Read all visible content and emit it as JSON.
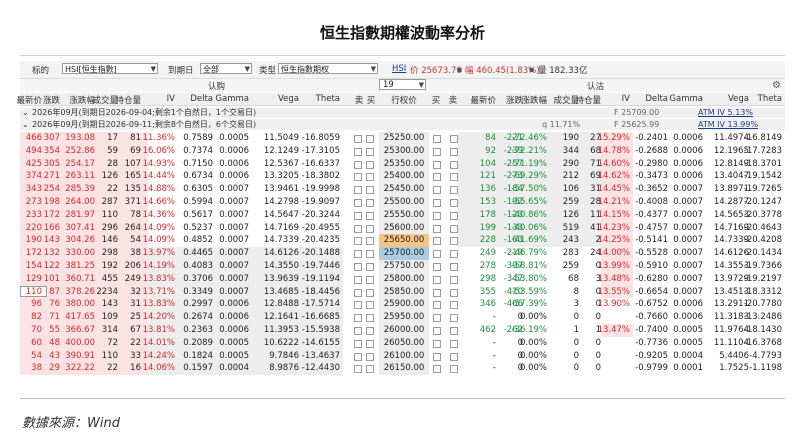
{
  "title": "恒生指數期權波動率分析",
  "source": "數據來源：Wind",
  "toolbar": {
    "underlying_label": "标的",
    "underlying_value": "HSI[恒生指數]",
    "expiry_label": "到期日",
    "expiry_value": "全部",
    "type_label": "类型",
    "type_value": "恒生指數期权",
    "index_link": "HSI",
    "index_price": "价 25673.76",
    "index_change": "幅 460.45(1.83%)",
    "index_volume": "量 182.33亿"
  },
  "section": {
    "call_label": "认购",
    "put_label": "认沽",
    "strike_selector": "19"
  },
  "headers": {
    "call": [
      "最新价",
      "涨跌",
      "涨跌幅",
      "成交量",
      "持仓量",
      "IV",
      "Delta",
      "Gamma",
      "Vega",
      "Theta",
      "卖",
      "买"
    ],
    "middle": [
      "行权价",
      "买",
      "卖"
    ],
    "put": [
      "最新价",
      "涨跌",
      "涨跌幅",
      "成交量",
      "持仓量",
      "IV",
      "Delta",
      "Gamma",
      "Vega",
      "Theta"
    ]
  },
  "groups": [
    {
      "label": "2026年09月(到期日2026-09-04;剩余1个自然日，1个交易日)",
      "right_f": "F 25709.00",
      "right_atm": "ATM IV 5.13%"
    },
    {
      "label": "2026年09月(到期日2026-09-11;剩余8个自然日，6个交易日)",
      "right_q": "q 11.71%",
      "right_f": "F 25625.99",
      "right_atm": "ATM IV 13.99%"
    }
  ],
  "rows": [
    {
      "call": [
        "466",
        "307",
        "193.08",
        "17",
        "81",
        "11.36%",
        "0.7589",
        "0.0005",
        "11.5049",
        "-16.8059"
      ],
      "strike": "25250.00",
      "put": [
        "84",
        "-221",
        "-72.46%",
        "190",
        "27",
        "15.29%",
        "-0.2401",
        "0.0006",
        "11.4974",
        "-16.8149"
      ]
    },
    {
      "call": [
        "494",
        "354",
        "252.86",
        "59",
        "69",
        "16.06%",
        "0.7374",
        "0.0006",
        "12.1249",
        "-17.3105"
      ],
      "strike": "25300.00",
      "put": [
        "92",
        "-239",
        "-72.21%",
        "344",
        "68",
        "14.78%",
        "-0.2688",
        "0.0006",
        "12.1965",
        "-17.7283"
      ]
    },
    {
      "call": [
        "425",
        "305",
        "254.17",
        "28",
        "107",
        "14.93%",
        "0.7150",
        "0.0006",
        "12.5367",
        "-16.6337"
      ],
      "strike": "25350.00",
      "put": [
        "104",
        "-257",
        "-71.19%",
        "290",
        "71",
        "14.60%",
        "-0.2980",
        "0.0006",
        "12.8149",
        "-18.3701"
      ]
    },
    {
      "call": [
        "374",
        "271",
        "263.11",
        "126",
        "165",
        "14.44%",
        "0.6734",
        "0.0006",
        "13.3205",
        "-18.3802"
      ],
      "strike": "25400.00",
      "put": [
        "121",
        "-273",
        "-69.29%",
        "212",
        "69",
        "14.62%",
        "-0.3473",
        "0.0006",
        "13.4047",
        "-19.1542"
      ]
    },
    {
      "call": [
        "343",
        "254",
        "285.39",
        "22",
        "135",
        "14.88%",
        "0.6305",
        "0.0007",
        "13.9461",
        "-19.9998"
      ],
      "strike": "25450.00",
      "put": [
        "136",
        "-184",
        "-57.50%",
        "106",
        "31",
        "14.45%",
        "-0.3652",
        "0.0007",
        "13.8971",
        "-19.7265"
      ]
    },
    {
      "call": [
        "273",
        "198",
        "264.00",
        "287",
        "371",
        "14.66%",
        "0.5994",
        "0.0007",
        "14.2798",
        "-19.9097"
      ],
      "strike": "25500.00",
      "put": [
        "153",
        "-192",
        "-55.65%",
        "259",
        "28",
        "14.21%",
        "-0.4008",
        "0.0007",
        "14.2877",
        "-20.1247"
      ]
    },
    {
      "call": [
        "233",
        "172",
        "281.97",
        "110",
        "78",
        "14.36%",
        "0.5617",
        "0.0007",
        "14.5647",
        "-20.3244"
      ],
      "strike": "25550.00",
      "put": [
        "178",
        "-123",
        "-40.86%",
        "126",
        "11",
        "14.15%",
        "-0.4377",
        "0.0007",
        "14.5653",
        "-20.3778"
      ]
    },
    {
      "call": [
        "220",
        "166",
        "307.41",
        "296",
        "264",
        "14.09%",
        "0.5237",
        "0.0007",
        "14.7169",
        "-20.4955"
      ],
      "strike": "25600.00",
      "put": [
        "199",
        "-133",
        "-40.06%",
        "519",
        "41",
        "14.23%",
        "-0.4757",
        "0.0007",
        "14.7169",
        "-20.4643"
      ]
    },
    {
      "call": [
        "190",
        "143",
        "304.26",
        "146",
        "54",
        "14.09%",
        "0.4852",
        "0.0007",
        "14.7339",
        "-20.4235"
      ],
      "strike": "25650.00",
      "put": [
        "228",
        "-163",
        "-41.69%",
        "243",
        "2",
        "14.25%",
        "-0.5141",
        "0.0007",
        "14.7339",
        "-20.4208"
      ]
    },
    {
      "call": [
        "172",
        "132",
        "330.00",
        "298",
        "38",
        "13.97%",
        "0.4465",
        "0.0007",
        "14.6126",
        "-20.1488"
      ],
      "strike": "25700.00",
      "put": [
        "249",
        "-219",
        "-46.79%",
        "283",
        "24",
        "14.00%",
        "-0.5528",
        "0.0007",
        "14.6126",
        "-20.1434"
      ]
    },
    {
      "call": [
        "154",
        "122",
        "381.25",
        "192",
        "206",
        "14.19%",
        "0.4083",
        "0.0007",
        "14.3550",
        "-19.7446"
      ],
      "strike": "25750.00",
      "put": [
        "278",
        "-397",
        "-58.81%",
        "259",
        "0",
        "13.99%",
        "-0.5910",
        "0.0007",
        "14.3553",
        "-19.7366"
      ]
    },
    {
      "call": [
        "129",
        "101",
        "360.71",
        "455",
        "249",
        "13.83%",
        "0.3706",
        "0.0007",
        "13.9639",
        "-19.1194"
      ],
      "strike": "25800.00",
      "put": [
        "298",
        "-347",
        "-53.80%",
        "68",
        "3",
        "13.48%",
        "-0.6280",
        "0.0007",
        "13.9729",
        "-19.2197"
      ]
    },
    {
      "call": [
        "110",
        "87",
        "378.26",
        "2234",
        "32",
        "13.71%",
        "0.3349",
        "0.0007",
        "13.4685",
        "-18.4456"
      ],
      "strike": "25850.00",
      "put": [
        "355",
        "-410",
        "-53.59%",
        "8",
        "0",
        "13.55%",
        "-0.6654",
        "0.0007",
        "13.4513",
        "-18.3312"
      ]
    },
    {
      "call": [
        "96",
        "76",
        "380.00",
        "143",
        "31",
        "13.83%",
        "0.2997",
        "0.0006",
        "12.8488",
        "-17.5714"
      ],
      "strike": "25900.00",
      "put": [
        "346",
        "-466",
        "-57.39%",
        "3",
        "0",
        "13.90%",
        "-0.6752",
        "0.0006",
        "13.2911",
        "-20.7780"
      ]
    },
    {
      "call": [
        "82",
        "71",
        "417.65",
        "109",
        "25",
        "14.20%",
        "0.2674",
        "0.0006",
        "12.1641",
        "-16.6685"
      ],
      "strike": "25950.00",
      "put": [
        "-",
        "0",
        "0.00%",
        "0",
        "0",
        "",
        "-0.7660",
        "0.0006",
        "11.3183",
        "-13.2486"
      ]
    },
    {
      "call": [
        "70",
        "55",
        "366.67",
        "314",
        "67",
        "13.81%",
        "0.2363",
        "0.0006",
        "11.3953",
        "-15.5938"
      ],
      "strike": "26000.00",
      "put": [
        "462",
        "-262",
        "-36.19%",
        "1",
        "1",
        "13.47%",
        "-0.7400",
        "0.0005",
        "11.9764",
        "-18.1430"
      ]
    },
    {
      "call": [
        "60",
        "48",
        "400.00",
        "72",
        "22",
        "14.01%",
        "0.2089",
        "0.0005",
        "10.6222",
        "-14.6155"
      ],
      "strike": "26050.00",
      "put": [
        "-",
        "0",
        "0.00%",
        "0",
        "0",
        "",
        "-0.7736",
        "0.0005",
        "11.1104",
        "-16.3768"
      ]
    },
    {
      "call": [
        "54",
        "43",
        "390.91",
        "110",
        "33",
        "14.24%",
        "0.1824",
        "0.0005",
        "9.7846",
        "-13.4637"
      ],
      "strike": "26100.00",
      "put": [
        "-",
        "0",
        "0.00%",
        "0",
        "0",
        "",
        "-0.9205",
        "0.0004",
        "5.4406",
        "-4.7793"
      ]
    },
    {
      "call": [
        "38",
        "29",
        "322.22",
        "22",
        "16",
        "14.06%",
        "0.1597",
        "0.0004",
        "8.9876",
        "-12.4430"
      ],
      "strike": "26150.00",
      "put": [
        "-",
        "0",
        "0.00%",
        "0",
        "0",
        "",
        "-0.9799",
        "0.0001",
        "1.7525",
        "-1.1198"
      ]
    }
  ]
}
